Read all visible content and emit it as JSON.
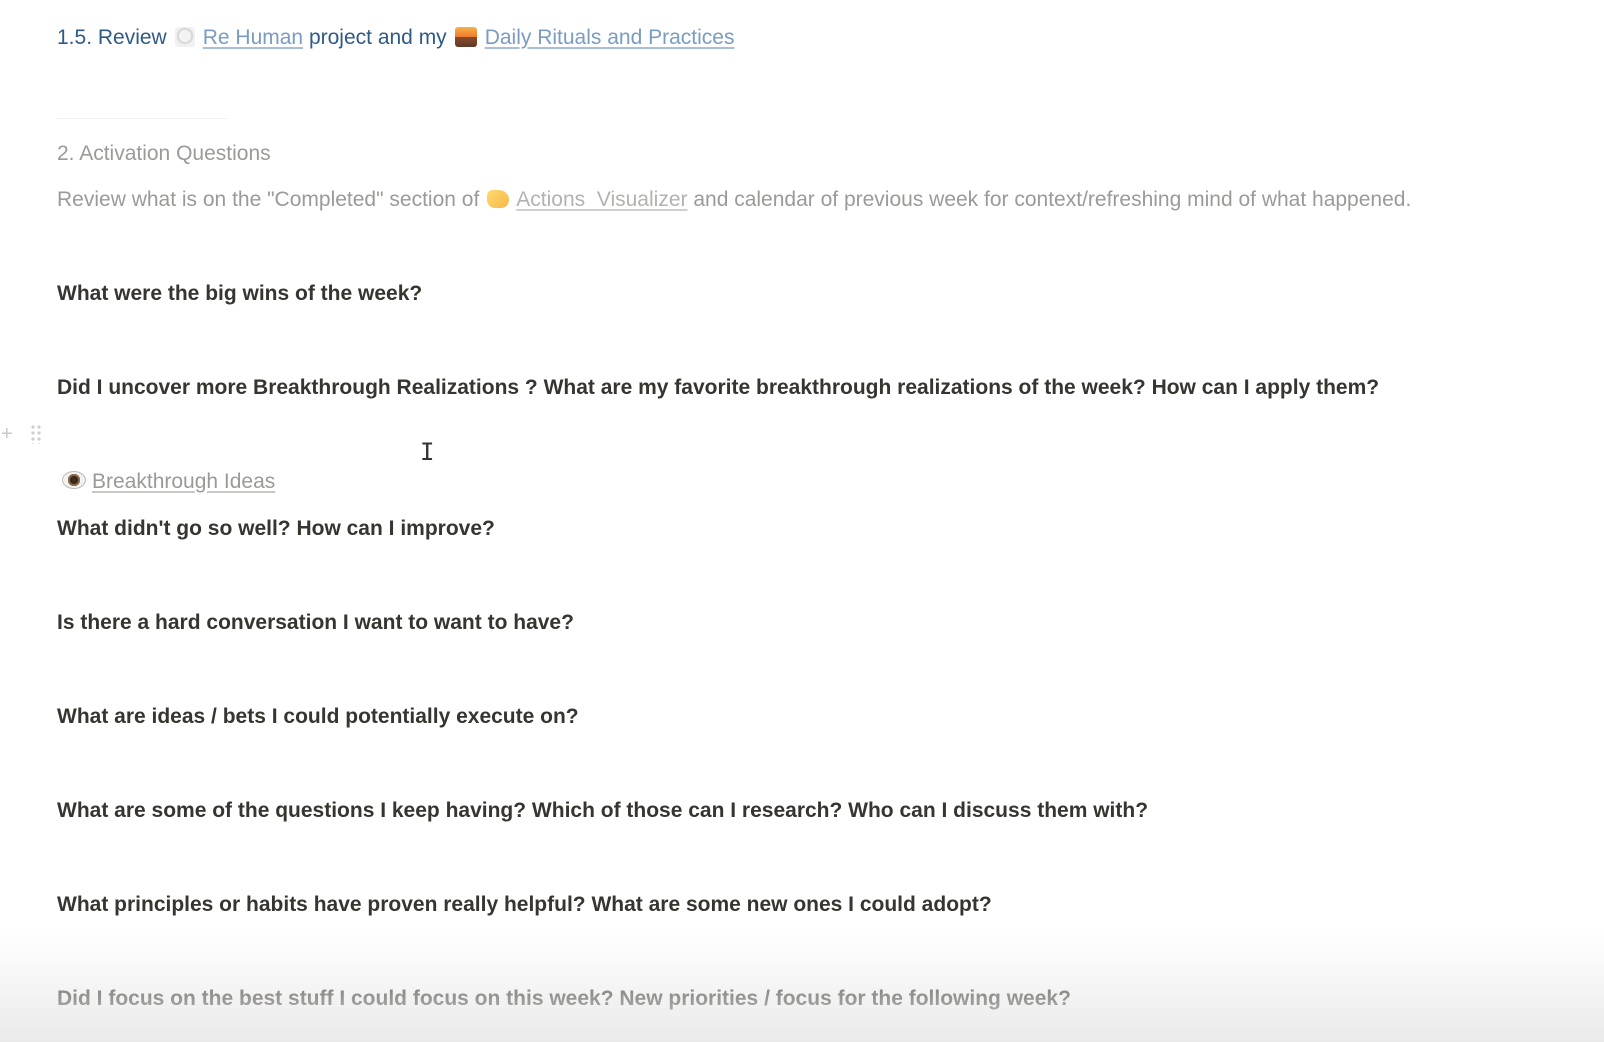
{
  "review_line": {
    "prefix": "1.5. Review",
    "link1_icon": "robot-human-icon",
    "link1": "Re Human",
    "middle": "project and my",
    "link2_icon": "sunset-icon",
    "link2": "Daily Rituals and Practices"
  },
  "activation": {
    "heading": "2. Activation Questions",
    "desc_prefix": "Review what is on the \"Completed\" section of",
    "link_icon": "backhand-pointing-icon",
    "link": "Actions  Visualizer",
    "desc_suffix": "and calendar of previous week for context/refreshing mind of what happened."
  },
  "questions": [
    "What were the big wins of the week?",
    "Did I uncover more Breakthrough Realizations ? What are my favorite breakthrough realizations of the week? How can I apply them?",
    "What didn't go so well? How can I improve?",
    "Is there a hard conversation I want to want to have?",
    "What are ideas / bets I could potentially execute on?",
    "What are some of the questions I keep having? Which of those can I research? Who can I discuss them with?",
    "What principles or habits have proven really helpful?  What are some new ones I could adopt?",
    "Did I focus on the best stuff I could focus on this week? New priorities / focus for the following week?"
  ],
  "breakthrough_link": {
    "icon": "eye-icon",
    "label": "Breakthrough Ideas"
  },
  "block_handle": {
    "add_icon": "plus-icon",
    "drag_icon": "drag-handle-icon"
  },
  "colors": {
    "heading_blue": "#2f5a86",
    "muted_gray": "#9b9a97",
    "text": "#37352f"
  }
}
